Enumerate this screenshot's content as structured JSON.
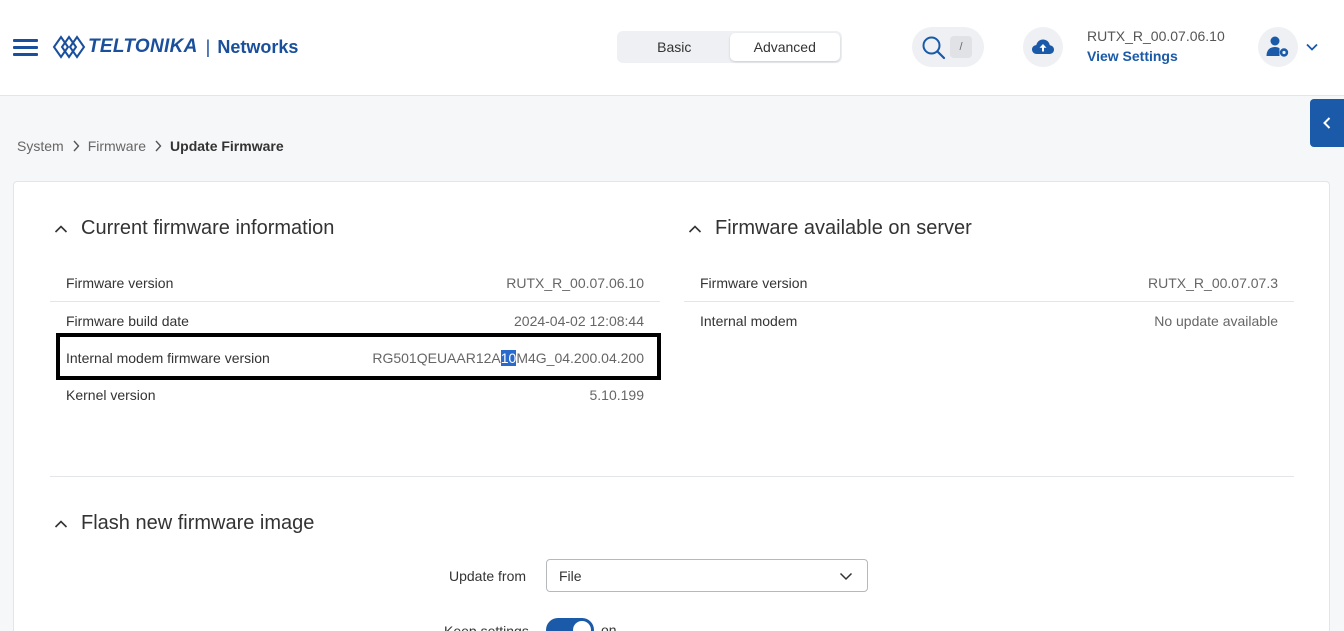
{
  "header": {
    "brand": "TELTONIKA",
    "divider": "|",
    "product": "Networks",
    "mode_basic": "Basic",
    "mode_advanced": "Advanced",
    "search_shortcut": "/",
    "firmware_version": "RUTX_R_00.07.06.10",
    "view_settings": "View Settings"
  },
  "breadcrumb": {
    "items": [
      "System",
      "Firmware",
      "Update Firmware"
    ]
  },
  "current_firmware": {
    "title": "Current firmware information",
    "rows": [
      {
        "label": "Firmware version",
        "value": "RUTX_R_00.07.06.10"
      },
      {
        "label": "Firmware build date",
        "value": "2024-04-02 12:08:44"
      },
      {
        "label": "Internal modem firmware version",
        "value_pre": "RG501QEUAAR12A",
        "value_selected": "10",
        "value_post": "M4G_04.200.04.200"
      },
      {
        "label": "Kernel version",
        "value": "5.10.199"
      }
    ]
  },
  "server_firmware": {
    "title": "Firmware available on server",
    "rows": [
      {
        "label": "Firmware version",
        "value": "RUTX_R_00.07.07.3"
      },
      {
        "label": "Internal modem",
        "value": "No update available"
      }
    ]
  },
  "flash": {
    "title": "Flash new firmware image",
    "update_from_label": "Update from",
    "update_from_value": "File",
    "keep_settings_label": "Keep settings",
    "keep_settings_state": "on"
  },
  "colors": {
    "accent": "#1a5aa8",
    "brand": "#1a4f9c",
    "highlight_border": "#000000",
    "selection": "#2a6acb"
  }
}
